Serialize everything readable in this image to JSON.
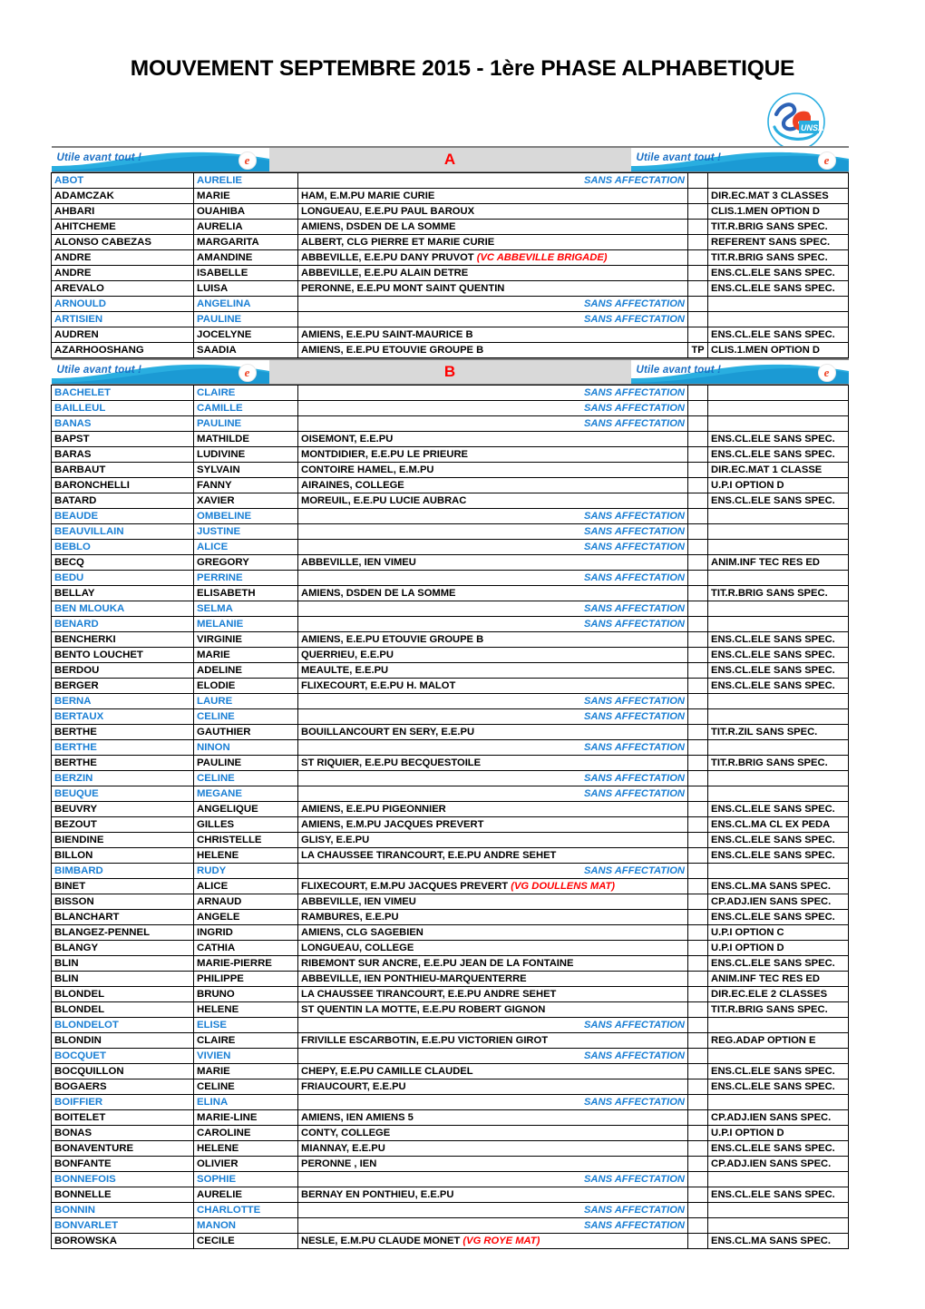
{
  "document": {
    "title": "MOUVEMENT SEPTEMBRE 2015 - 1ère PHASE ALPHABETIQUE",
    "logo_name": "se-unsa-logo",
    "logo_text": "SE UNSA"
  },
  "colors": {
    "accent_blue": "#1a7fd4",
    "banner_cyan": "#29aee0",
    "annotation_red": "#ff0000",
    "letter_red": "#ff0000",
    "band_gray": "#d9d9d9"
  },
  "banner": {
    "slogan": "Utile avant tout !",
    "badge_glyph": "e"
  },
  "sans_affectation_label": "SANS AFFECTATION",
  "sections": [
    {
      "letter": "A",
      "rows": [
        {
          "nom": "ABOT",
          "prenom": "AURELIE",
          "affectation": "",
          "annot": "",
          "tp": "",
          "poste": "",
          "sans": true
        },
        {
          "nom": "ADAMCZAK",
          "prenom": "MARIE",
          "affectation": "HAM, E.M.PU MARIE CURIE",
          "annot": "",
          "tp": "",
          "poste": "DIR.EC.MAT 3 CLASSES",
          "sans": false
        },
        {
          "nom": "AHBARI",
          "prenom": "OUAHIBA",
          "affectation": "LONGUEAU, E.E.PU PAUL BAROUX",
          "annot": "",
          "tp": "",
          "poste": "CLIS.1.MEN OPTION D",
          "sans": false
        },
        {
          "nom": "AHITCHEME",
          "prenom": "AURELIA",
          "affectation": "AMIENS, DSDEN  DE LA SOMME",
          "annot": "",
          "tp": "",
          "poste": "TIT.R.BRIG SANS SPEC.",
          "sans": false
        },
        {
          "nom": "ALONSO CABEZAS",
          "prenom": "MARGARITA",
          "affectation": "ALBERT, CLG  PIERRE ET MARIE CURIE",
          "annot": "",
          "tp": "",
          "poste": "REFERENT SANS SPEC.",
          "sans": false
        },
        {
          "nom": "ANDRE",
          "prenom": "AMANDINE",
          "affectation": "ABBEVILLE, E.E.PU DANY PRUVOT",
          "annot": "(VC ABBEVILLE BRIGADE)",
          "tp": "",
          "poste": "TIT.R.BRIG SANS SPEC.",
          "sans": false
        },
        {
          "nom": "ANDRE",
          "prenom": "ISABELLE",
          "affectation": "ABBEVILLE, E.E.PU ALAIN DETRE",
          "annot": "",
          "tp": "",
          "poste": "ENS.CL.ELE SANS SPEC.",
          "sans": false
        },
        {
          "nom": "AREVALO",
          "prenom": "LUISA",
          "affectation": "PERONNE, E.E.PU MONT SAINT QUENTIN",
          "annot": "",
          "tp": "",
          "poste": "ENS.CL.ELE SANS SPEC.",
          "sans": false
        },
        {
          "nom": "ARNOULD",
          "prenom": "ANGELINA",
          "affectation": "",
          "annot": "",
          "tp": "",
          "poste": "",
          "sans": true
        },
        {
          "nom": "ARTISIEN",
          "prenom": "PAULINE",
          "affectation": "",
          "annot": "",
          "tp": "",
          "poste": "",
          "sans": true
        },
        {
          "nom": "AUDREN",
          "prenom": "JOCELYNE",
          "affectation": "AMIENS, E.E.PU SAINT-MAURICE B",
          "annot": "",
          "tp": "",
          "poste": "ENS.CL.ELE SANS SPEC.",
          "sans": false
        },
        {
          "nom": "AZARHOOSHANG",
          "prenom": "SAADIA",
          "affectation": "AMIENS, E.E.PU ETOUVIE GROUPE B",
          "annot": "",
          "tp": "TP",
          "poste": "CLIS.1.MEN OPTION D",
          "sans": false
        }
      ]
    },
    {
      "letter": "B",
      "rows": [
        {
          "nom": "BACHELET",
          "prenom": "CLAIRE",
          "affectation": "",
          "annot": "",
          "tp": "",
          "poste": "",
          "sans": true
        },
        {
          "nom": "BAILLEUL",
          "prenom": "CAMILLE",
          "affectation": "",
          "annot": "",
          "tp": "",
          "poste": "",
          "sans": true
        },
        {
          "nom": "BANAS",
          "prenom": "PAULINE",
          "affectation": "",
          "annot": "",
          "tp": "",
          "poste": "",
          "sans": true
        },
        {
          "nom": "BAPST",
          "prenom": "MATHILDE",
          "affectation": "OISEMONT, E.E.PU",
          "annot": "",
          "tp": "",
          "poste": "ENS.CL.ELE SANS SPEC.",
          "sans": false
        },
        {
          "nom": "BARAS",
          "prenom": "LUDIVINE",
          "affectation": "MONTDIDIER, E.E.PU LE PRIEURE",
          "annot": "",
          "tp": "",
          "poste": "ENS.CL.ELE SANS SPEC.",
          "sans": false
        },
        {
          "nom": "BARBAUT",
          "prenom": "SYLVAIN",
          "affectation": "CONTOIRE HAMEL, E.M.PU",
          "annot": "",
          "tp": "",
          "poste": "DIR.EC.MAT 1 CLASSE",
          "sans": false
        },
        {
          "nom": "BARONCHELLI",
          "prenom": "FANNY",
          "affectation": "AIRAINES, COLLEGE",
          "annot": "",
          "tp": "",
          "poste": "U.P.I OPTION D",
          "sans": false
        },
        {
          "nom": "BATARD",
          "prenom": "XAVIER",
          "affectation": "MOREUIL, E.E.PU LUCIE AUBRAC",
          "annot": "",
          "tp": "",
          "poste": "ENS.CL.ELE SANS SPEC.",
          "sans": false
        },
        {
          "nom": "BEAUDE",
          "prenom": "OMBELINE",
          "affectation": "",
          "annot": "",
          "tp": "",
          "poste": "",
          "sans": true
        },
        {
          "nom": "BEAUVILLAIN",
          "prenom": "JUSTINE",
          "affectation": "",
          "annot": "",
          "tp": "",
          "poste": "",
          "sans": true
        },
        {
          "nom": "BEBLO",
          "prenom": "ALICE",
          "affectation": "",
          "annot": "",
          "tp": "",
          "poste": "",
          "sans": true
        },
        {
          "nom": "BECQ",
          "prenom": "GREGORY",
          "affectation": "ABBEVILLE, IEN VIMEU",
          "annot": "",
          "tp": "",
          "poste": "ANIM.INF TEC RES ED",
          "sans": false
        },
        {
          "nom": "BEDU",
          "prenom": "PERRINE",
          "affectation": "",
          "annot": "",
          "tp": "",
          "poste": "",
          "sans": true
        },
        {
          "nom": "BELLAY",
          "prenom": "ELISABETH",
          "affectation": "AMIENS, DSDEN DE LA SOMME",
          "annot": "",
          "tp": "",
          "poste": "TIT.R.BRIG SANS SPEC.",
          "sans": false
        },
        {
          "nom": "BEN MLOUKA",
          "prenom": "SELMA",
          "affectation": "",
          "annot": "",
          "tp": "",
          "poste": "",
          "sans": true
        },
        {
          "nom": "BENARD",
          "prenom": "MELANIE",
          "affectation": "",
          "annot": "",
          "tp": "",
          "poste": "",
          "sans": true
        },
        {
          "nom": "BENCHERKI",
          "prenom": "VIRGINIE",
          "affectation": "AMIENS, E.E.PU ETOUVIE GROUPE B",
          "annot": "",
          "tp": "",
          "poste": "ENS.CL.ELE SANS SPEC.",
          "sans": false
        },
        {
          "nom": "BENTO LOUCHET",
          "prenom": "MARIE",
          "affectation": "QUERRIEU, E.E.PU",
          "annot": "",
          "tp": "",
          "poste": "ENS.CL.ELE SANS SPEC.",
          "sans": false
        },
        {
          "nom": "BERDOU",
          "prenom": "ADELINE",
          "affectation": "MEAULTE, E.E.PU",
          "annot": "",
          "tp": "",
          "poste": "ENS.CL.ELE SANS SPEC.",
          "sans": false
        },
        {
          "nom": "BERGER",
          "prenom": "ELODIE",
          "affectation": "FLIXECOURT, E.E.PU H. MALOT",
          "annot": "",
          "tp": "",
          "poste": "ENS.CL.ELE SANS SPEC.",
          "sans": false
        },
        {
          "nom": "BERNA",
          "prenom": "LAURE",
          "affectation": "",
          "annot": "",
          "tp": "",
          "poste": "",
          "sans": true
        },
        {
          "nom": "BERTAUX",
          "prenom": "CELINE",
          "affectation": "",
          "annot": "",
          "tp": "",
          "poste": "",
          "sans": true
        },
        {
          "nom": "BERTHE",
          "prenom": "GAUTHIER",
          "affectation": "BOUILLANCOURT EN SERY, E.E.PU",
          "annot": "",
          "tp": "",
          "poste": "TIT.R.ZIL SANS SPEC.",
          "sans": false
        },
        {
          "nom": "BERTHE",
          "prenom": "NINON",
          "affectation": "",
          "annot": "",
          "tp": "",
          "poste": "",
          "sans": true
        },
        {
          "nom": "BERTHE",
          "prenom": "PAULINE",
          "affectation": "ST RIQUIER, E.E.PU BECQUESTOILE",
          "annot": "",
          "tp": "",
          "poste": "TIT.R.BRIG SANS SPEC.",
          "sans": false
        },
        {
          "nom": "BERZIN",
          "prenom": "CELINE",
          "affectation": "",
          "annot": "",
          "tp": "",
          "poste": "",
          "sans": true
        },
        {
          "nom": "BEUQUE",
          "prenom": "MEGANE",
          "affectation": "",
          "annot": "",
          "tp": "",
          "poste": "",
          "sans": true
        },
        {
          "nom": "BEUVRY",
          "prenom": "ANGELIQUE",
          "affectation": "AMIENS, E.E.PU PIGEONNIER",
          "annot": "",
          "tp": "",
          "poste": "ENS.CL.ELE SANS SPEC.",
          "sans": false
        },
        {
          "nom": "BEZOUT",
          "prenom": "GILLES",
          "affectation": "AMIENS, E.M.PU JACQUES PREVERT",
          "annot": "",
          "tp": "",
          "poste": "ENS.CL.MA CL EX PEDA",
          "sans": false
        },
        {
          "nom": "BIENDINE",
          "prenom": "CHRISTELLE",
          "affectation": "GLISY, E.E.PU",
          "annot": "",
          "tp": "",
          "poste": "ENS.CL.ELE SANS SPEC.",
          "sans": false
        },
        {
          "nom": "BILLON",
          "prenom": "HELENE",
          "affectation": "LA CHAUSSEE TIRANCOURT, E.E.PU ANDRE SEHET",
          "annot": "",
          "tp": "",
          "poste": "ENS.CL.ELE SANS SPEC.",
          "sans": false
        },
        {
          "nom": "BIMBARD",
          "prenom": "RUDY",
          "affectation": "",
          "annot": "",
          "tp": "",
          "poste": "",
          "sans": true
        },
        {
          "nom": "BINET",
          "prenom": "ALICE",
          "affectation": "FLIXECOURT, E.M.PU JACQUES PREVERT",
          "annot": "(VG DOULLENS MAT)",
          "tp": "",
          "poste": "ENS.CL.MA SANS SPEC.",
          "sans": false
        },
        {
          "nom": "BISSON",
          "prenom": "ARNAUD",
          "affectation": "ABBEVILLE, IEN VIMEU",
          "annot": "",
          "tp": "",
          "poste": "CP.ADJ.IEN SANS SPEC.",
          "sans": false
        },
        {
          "nom": "BLANCHART",
          "prenom": "ANGELE",
          "affectation": "RAMBURES, E.E.PU",
          "annot": "",
          "tp": "",
          "poste": "ENS.CL.ELE SANS SPEC.",
          "sans": false
        },
        {
          "nom": "BLANGEZ-PENNEL",
          "prenom": "INGRID",
          "affectation": "AMIENS, CLG    SAGEBIEN",
          "annot": "",
          "tp": "",
          "poste": "U.P.I OPTION C",
          "sans": false
        },
        {
          "nom": "BLANGY",
          "prenom": "CATHIA",
          "affectation": "LONGUEAU, COLLEGE",
          "annot": "",
          "tp": "",
          "poste": "U.P.I OPTION D",
          "sans": false
        },
        {
          "nom": "BLIN",
          "prenom": "MARIE-PIERRE",
          "affectation": "RIBEMONT SUR ANCRE, E.E.PU JEAN DE LA FONTAINE",
          "annot": "",
          "tp": "",
          "poste": "ENS.CL.ELE SANS SPEC.",
          "sans": false
        },
        {
          "nom": "BLIN",
          "prenom": "PHILIPPE",
          "affectation": "ABBEVILLE, IEN PONTHIEU-MARQUENTERRE",
          "annot": "",
          "tp": "",
          "poste": "ANIM.INF TEC RES ED",
          "sans": false
        },
        {
          "nom": "BLONDEL",
          "prenom": "BRUNO",
          "affectation": "LA CHAUSSEE TIRANCOURT, E.E.PU ANDRE SEHET",
          "annot": "",
          "tp": "",
          "poste": "DIR.EC.ELE 2 CLASSES",
          "sans": false
        },
        {
          "nom": "BLONDEL",
          "prenom": "HELENE",
          "affectation": "ST QUENTIN LA MOTTE, E.E.PU ROBERT GIGNON",
          "annot": "",
          "tp": "",
          "poste": "TIT.R.BRIG SANS SPEC.",
          "sans": false
        },
        {
          "nom": "BLONDELOT",
          "prenom": "ELISE",
          "affectation": "",
          "annot": "",
          "tp": "",
          "poste": "",
          "sans": true
        },
        {
          "nom": "BLONDIN",
          "prenom": "CLAIRE",
          "affectation": "FRIVILLE ESCARBOTIN, E.E.PU VICTORIEN GIROT",
          "annot": "",
          "tp": "",
          "poste": "REG.ADAP OPTION E",
          "sans": false
        },
        {
          "nom": "BOCQUET",
          "prenom": "VIVIEN",
          "affectation": "",
          "annot": "",
          "tp": "",
          "poste": "",
          "sans": true
        },
        {
          "nom": "BOCQUILLON",
          "prenom": "MARIE",
          "affectation": "CHEPY, E.E.PU CAMILLE CLAUDEL",
          "annot": "",
          "tp": "",
          "poste": "ENS.CL.ELE SANS SPEC.",
          "sans": false
        },
        {
          "nom": "BOGAERS",
          "prenom": "CELINE",
          "affectation": "FRIAUCOURT, E.E.PU",
          "annot": "",
          "tp": "",
          "poste": "ENS.CL.ELE SANS SPEC.",
          "sans": false
        },
        {
          "nom": "BOIFFIER",
          "prenom": "ELINA",
          "affectation": "",
          "annot": "",
          "tp": "",
          "poste": "",
          "sans": true
        },
        {
          "nom": "BOITELET",
          "prenom": "MARIE-LINE",
          "affectation": "AMIENS, IEN AMIENS 5",
          "annot": "",
          "tp": "",
          "poste": "CP.ADJ.IEN SANS SPEC.",
          "sans": false
        },
        {
          "nom": "BONAS",
          "prenom": "CAROLINE",
          "affectation": "CONTY, COLLEGE",
          "annot": "",
          "tp": "",
          "poste": "U.P.I OPTION D",
          "sans": false
        },
        {
          "nom": "BONAVENTURE",
          "prenom": "HELENE",
          "affectation": "MIANNAY, E.E.PU",
          "annot": "",
          "tp": "",
          "poste": "ENS.CL.ELE SANS SPEC.",
          "sans": false
        },
        {
          "nom": "BONFANTE",
          "prenom": "OLIVIER",
          "affectation": "PERONNE , IEN",
          "annot": "",
          "tp": "",
          "poste": "CP.ADJ.IEN SANS SPEC.",
          "sans": false
        },
        {
          "nom": "BONNEFOIS",
          "prenom": "SOPHIE",
          "affectation": "",
          "annot": "",
          "tp": "",
          "poste": "",
          "sans": true
        },
        {
          "nom": "BONNELLE",
          "prenom": "AURELIE",
          "affectation": "BERNAY EN PONTHIEU, E.E.PU",
          "annot": "",
          "tp": "",
          "poste": "ENS.CL.ELE SANS SPEC.",
          "sans": false
        },
        {
          "nom": "BONNIN",
          "prenom": "CHARLOTTE",
          "affectation": "",
          "annot": "",
          "tp": "",
          "poste": "",
          "sans": true
        },
        {
          "nom": "BONVARLET",
          "prenom": "MANON",
          "affectation": "",
          "annot": "",
          "tp": "",
          "poste": "",
          "sans": true
        },
        {
          "nom": "BOROWSKA",
          "prenom": "CECILE",
          "affectation": "NESLE, E.M.PU CLAUDE MONET",
          "annot": "(VG ROYE MAT)",
          "tp": "",
          "poste": "ENS.CL.MA SANS SPEC.",
          "sans": false
        }
      ]
    }
  ]
}
